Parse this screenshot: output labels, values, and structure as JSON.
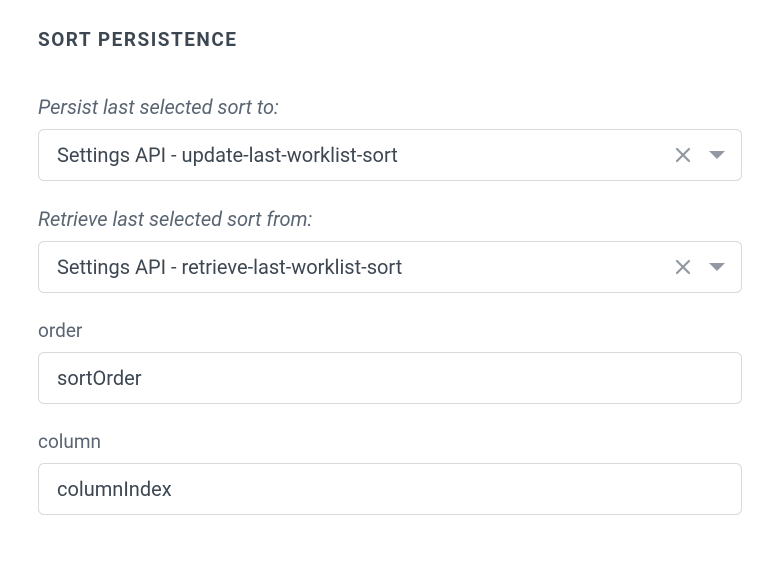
{
  "section": {
    "title": "SORT PERSISTENCE"
  },
  "persist": {
    "label": "Persist last selected sort to:",
    "value": "Settings API - update-last-worklist-sort"
  },
  "retrieve": {
    "label": "Retrieve last selected sort from:",
    "value": "Settings API - retrieve-last-worklist-sort"
  },
  "order": {
    "label": "order",
    "value": "sortOrder"
  },
  "column": {
    "label": "column",
    "value": "columnIndex"
  }
}
